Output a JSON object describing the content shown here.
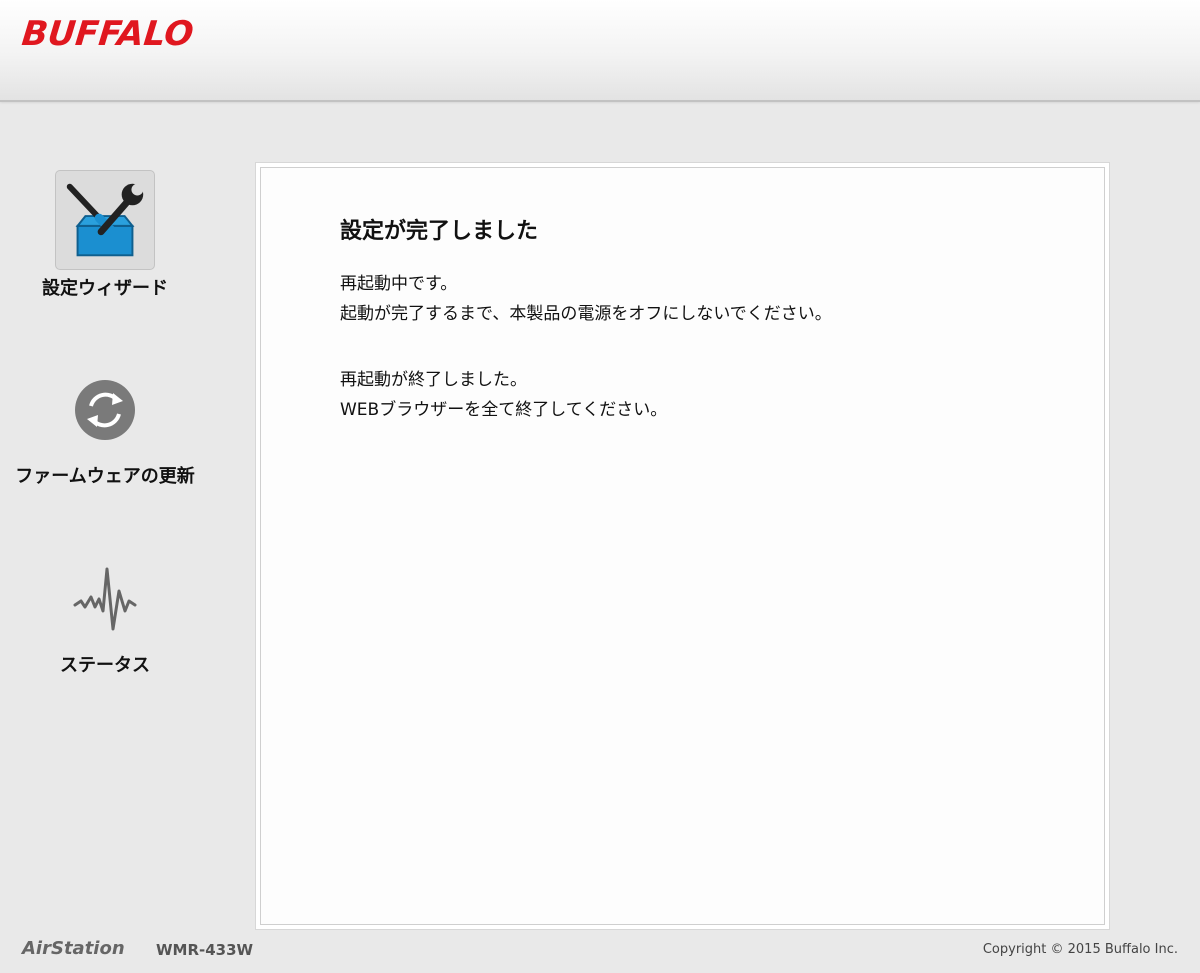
{
  "header": {
    "logo_text": "BUFFALO",
    "logo_color": "#e0171f"
  },
  "sidebar": {
    "items": [
      {
        "label": "設定ウィザード",
        "icon": "toolbox-wrench-screwdriver-icon",
        "active": true
      },
      {
        "label": "ファームウェアの更新",
        "icon": "refresh-arrows-icon",
        "active": false
      },
      {
        "label": "ステータス",
        "icon": "pulse-waveform-icon",
        "active": false
      }
    ]
  },
  "main": {
    "title": "設定が完了しました",
    "paragraphs": [
      {
        "lines": [
          "再起動中です。",
          "起動が完了するまで、本製品の電源をオフにしないでください。"
        ]
      },
      {
        "lines": [
          "再起動が終了しました。",
          "WEBブラウザーを全て終了してください。"
        ]
      }
    ]
  },
  "footer": {
    "brand": "AirStation",
    "model": "WMR-433W",
    "copyright": "Copyright © 2015 Buffalo Inc."
  },
  "colors": {
    "accent_blue": "#1b8fd0",
    "icon_gray": "#7a7a7a",
    "brand_red": "#e0171f"
  }
}
